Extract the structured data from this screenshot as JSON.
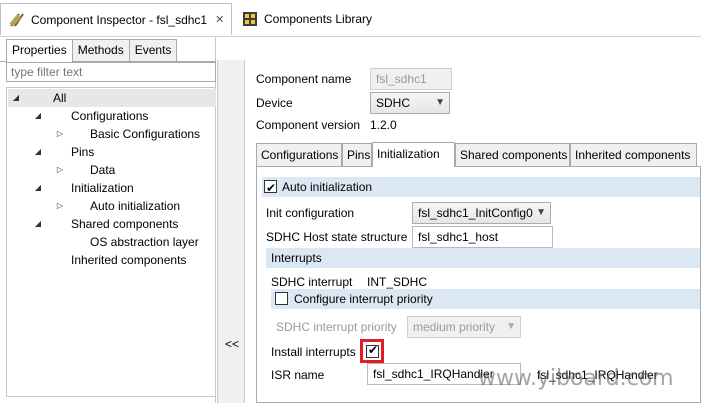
{
  "editor_tabs": [
    {
      "label": "Component Inspector - fsl_sdhc1",
      "close": "✕"
    },
    {
      "label": "Components Library"
    }
  ],
  "view_tabs": [
    "Properties",
    "Methods",
    "Events"
  ],
  "filter": {
    "placeholder": "type filter text"
  },
  "tree": [
    {
      "label": "All",
      "expander": "◢"
    },
    {
      "label": "Configurations",
      "expander": "◢"
    },
    {
      "label": "Basic Configurations",
      "expander": "▷"
    },
    {
      "label": "Pins",
      "expander": "◢"
    },
    {
      "label": "Data",
      "expander": "▷"
    },
    {
      "label": "Initialization",
      "expander": "◢"
    },
    {
      "label": "Auto initialization",
      "expander": "▷"
    },
    {
      "label": "Shared components",
      "expander": "◢"
    },
    {
      "label": "OS abstraction layer"
    },
    {
      "label": "Inherited components"
    }
  ],
  "splitter": {
    "collapse_label": "<<"
  },
  "component": {
    "name_label": "Component name",
    "name_value": "fsl_sdhc1",
    "device_label": "Device",
    "device_value": "SDHC",
    "version_label": "Component version",
    "version_value": "1.2.0"
  },
  "inner_tabs": [
    "Configurations",
    "Pins",
    "Initialization",
    "Shared components",
    "Inherited components"
  ],
  "init": {
    "auto_label": "Auto initialization",
    "auto_checked": true,
    "config_label": "Init configuration",
    "config_value": "fsl_sdhc1_InitConfig0",
    "host_label": "SDHC Host state structure",
    "host_value": "fsl_sdhc1_host",
    "interrupts_header": "Interrupts",
    "sdhc_interrupt_label": "SDHC interrupt",
    "sdhc_interrupt_value": "INT_SDHC",
    "configure_priority_label": "Configure interrupt priority",
    "configure_priority_checked": false,
    "priority_label": "SDHC interrupt priority",
    "priority_value": "medium priority",
    "install_label": "Install interrupts",
    "install_checked": true,
    "isr_label": "ISR name",
    "isr_value": "fsl_sdhc1_IRQHandler",
    "isr_display": "fsl_sdhc1_IRQHandler"
  },
  "watermark": "www.yiboard.com",
  "colors": {
    "section": "#dce7f4",
    "highlight": "#e31b23"
  }
}
